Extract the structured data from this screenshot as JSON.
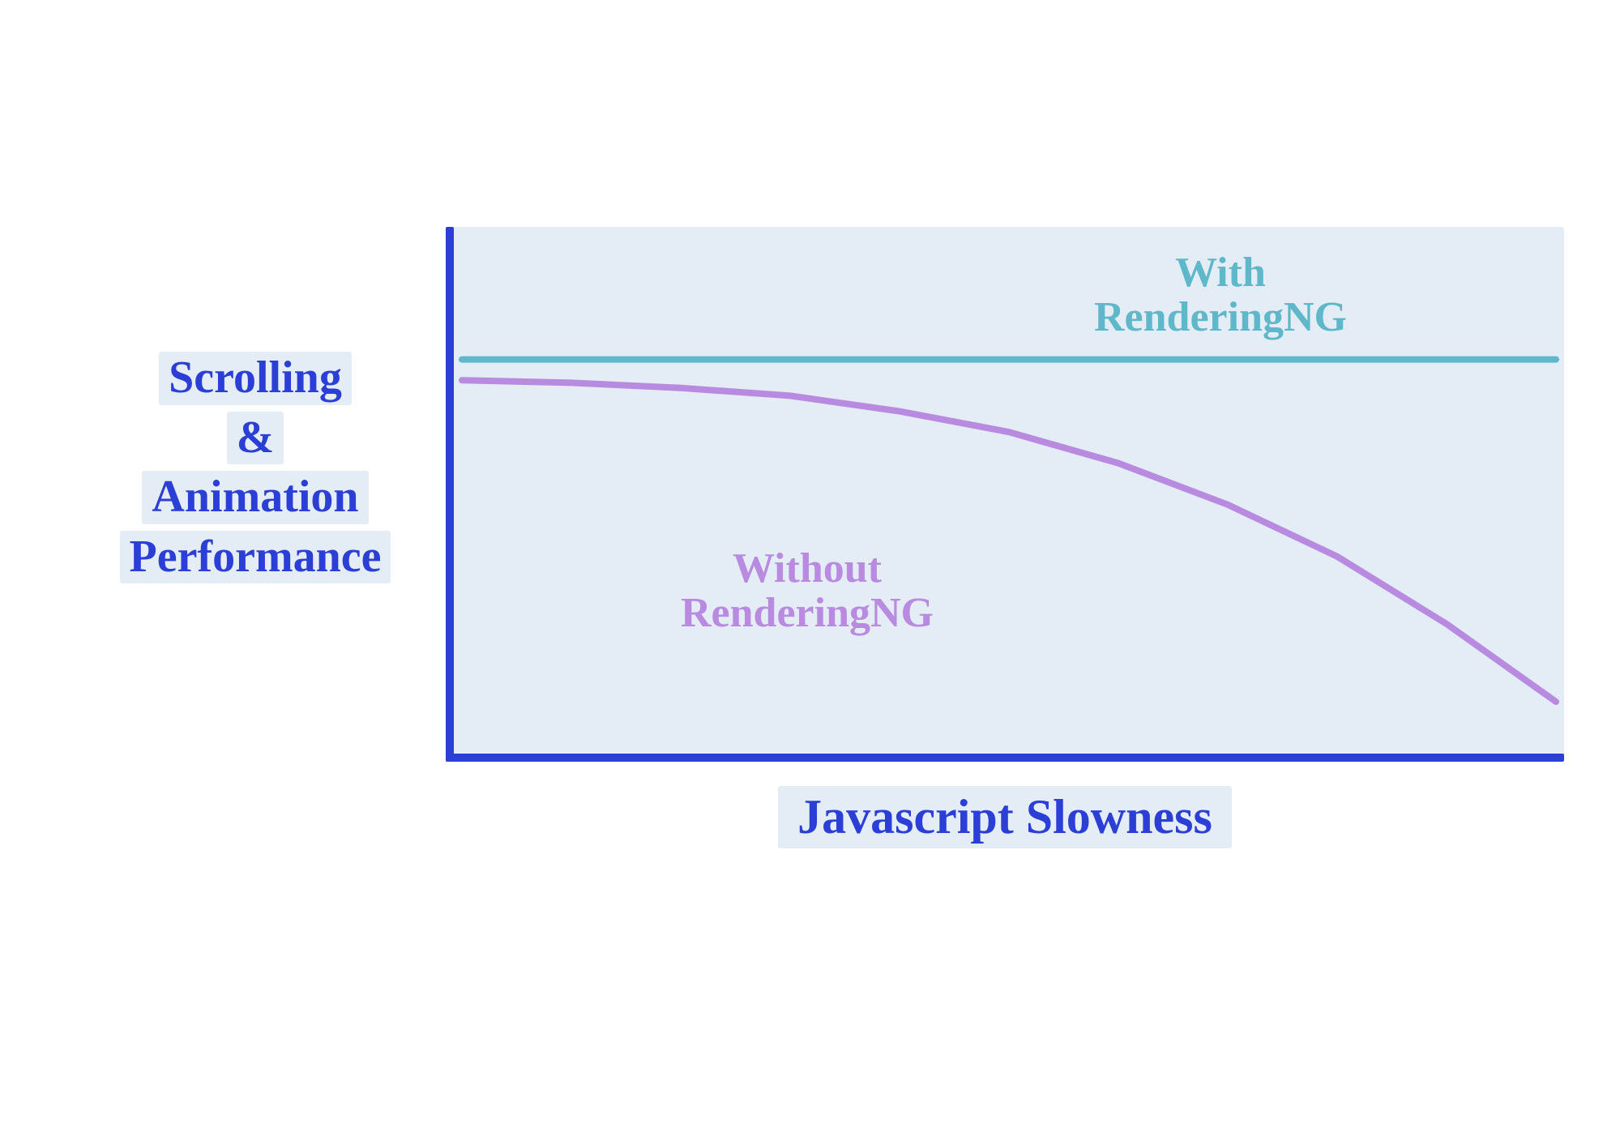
{
  "chart_data": {
    "type": "line",
    "title": "",
    "xlabel": "Javascript Slowness",
    "ylabel_lines": [
      "Scrolling",
      "&",
      "Animation",
      "Performance"
    ],
    "xlim": [
      0,
      10
    ],
    "ylim": [
      0,
      10
    ],
    "series": [
      {
        "name": "With RenderingNG",
        "label_lines": "With\nRenderingNG",
        "color": "#5fb8c9",
        "x": [
          0,
          1,
          2,
          3,
          4,
          5,
          6,
          7,
          8,
          9,
          10
        ],
        "values": [
          7.6,
          7.6,
          7.6,
          7.6,
          7.6,
          7.6,
          7.6,
          7.6,
          7.6,
          7.6,
          7.6
        ]
      },
      {
        "name": "Without RenderingNG",
        "label_lines": "Without\nRenderingNG",
        "color": "#b88ae0",
        "x": [
          0,
          1,
          2,
          3,
          4,
          5,
          6,
          7,
          8,
          9,
          10
        ],
        "values": [
          7.2,
          7.15,
          7.05,
          6.9,
          6.6,
          6.2,
          5.6,
          4.8,
          3.8,
          2.5,
          1.0
        ]
      }
    ]
  },
  "colors": {
    "axis": "#2b3fd6",
    "plot_bg": "#e4ecf5"
  }
}
